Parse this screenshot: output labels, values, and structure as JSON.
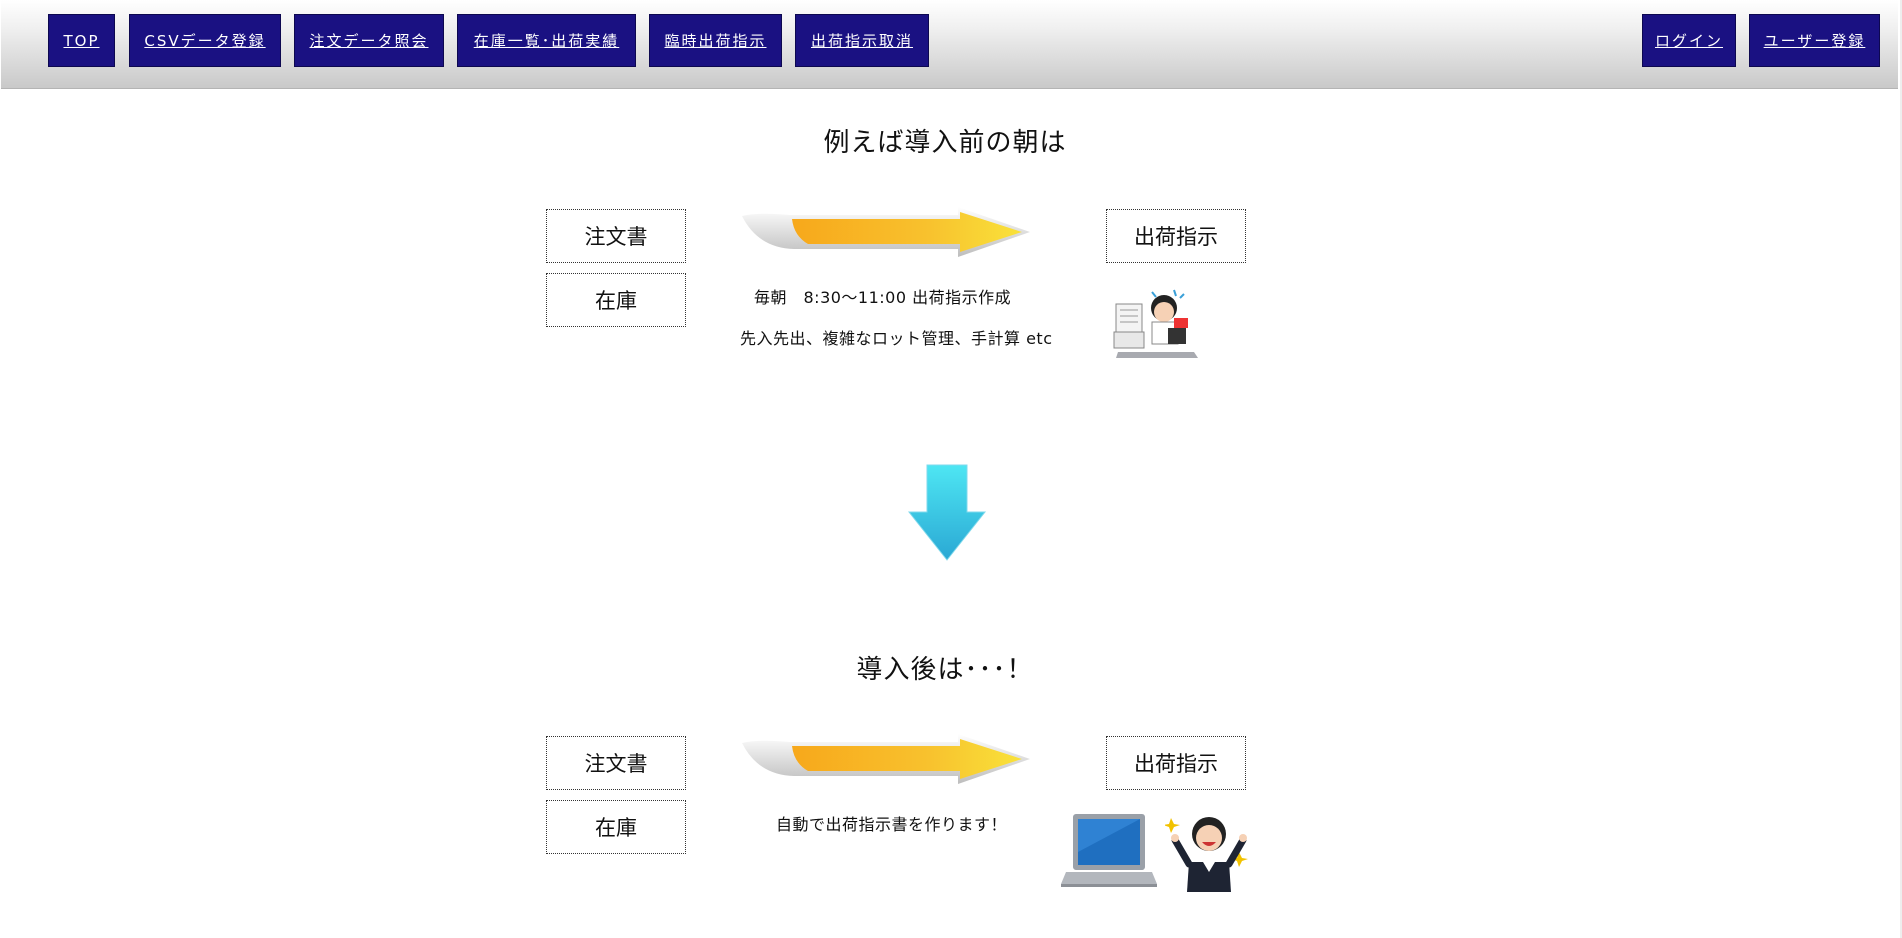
{
  "nav": {
    "left": [
      {
        "label": "TOP"
      },
      {
        "label": "CSVデータ登録"
      },
      {
        "label": "注文データ照会"
      },
      {
        "label": "在庫一覧･出荷実績"
      },
      {
        "label": "臨時出荷指示"
      },
      {
        "label": "出荷指示取消"
      }
    ],
    "right": [
      {
        "label": "ログイン"
      },
      {
        "label": "ユーザー登録"
      }
    ]
  },
  "before": {
    "heading": "例えば導入前の朝は",
    "order_box": "注文書",
    "stock_box": "在庫",
    "result_box": "出荷指示",
    "note_line1": "毎朝　8:30〜11:00 出荷指示作成",
    "note_line2": "先入先出、複雑なロット管理、手計算 etc"
  },
  "after": {
    "heading": "導入後は･･･！",
    "order_box": "注文書",
    "stock_box": "在庫",
    "result_box": "出荷指示",
    "note_line1": "自動で出荷指示書を作ります！"
  },
  "colors": {
    "nav_bg": "#1a1182",
    "arrow_orange": "#f7b731",
    "arrow_yellow": "#f9d71c",
    "down_arrow": "#35c7e6"
  },
  "icons": [
    "orange-right-arrow",
    "blue-down-arrow",
    "busy-worker-illustration",
    "laptop-illustration",
    "happy-worker-illustration"
  ]
}
